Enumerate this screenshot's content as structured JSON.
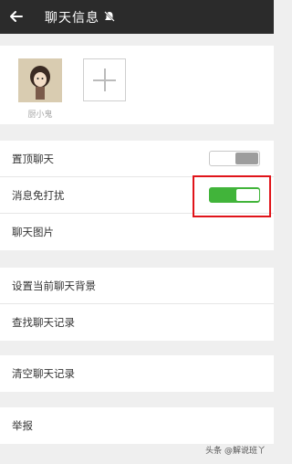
{
  "titlebar": {
    "back_icon": "back-arrow-icon",
    "title": "聊天信息",
    "mute_icon": "bell-muted-icon"
  },
  "members": {
    "items": [
      {
        "name": "厨小鬼",
        "avatar_icon": "avatar-icon"
      }
    ],
    "add_icon": "plus-icon"
  },
  "settings": {
    "group1": [
      {
        "label": "置顶聊天",
        "control": "toggle",
        "value": false
      },
      {
        "label": "消息免打扰",
        "control": "toggle",
        "value": true
      },
      {
        "label": "聊天图片",
        "control": "none"
      }
    ],
    "group2": [
      {
        "label": "设置当前聊天背景"
      },
      {
        "label": "查找聊天记录"
      }
    ],
    "group3": [
      {
        "label": "清空聊天记录"
      }
    ],
    "group4": [
      {
        "label": "举报"
      }
    ]
  },
  "watermark": "头条 @解说班丫",
  "colors": {
    "titlebar_bg": "#2b2b2b",
    "page_bg": "#efefef",
    "toggle_on": "#41b43a",
    "highlight": "#e0141a"
  }
}
